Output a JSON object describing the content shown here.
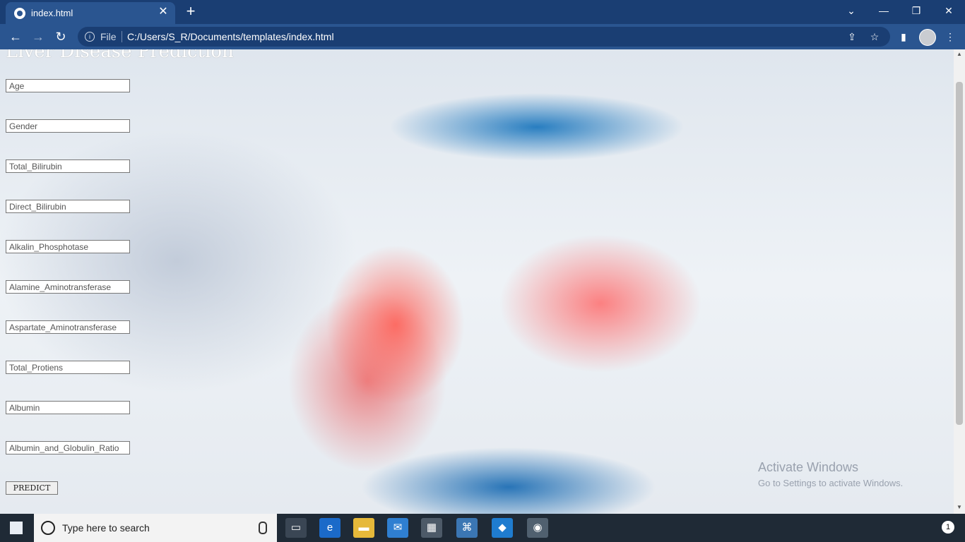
{
  "browser": {
    "tab_title": "index.html",
    "tab_close": "✕",
    "new_tab": "+",
    "window": {
      "dropdown": "⌄",
      "minimize": "—",
      "restore": "❐",
      "close": "✕"
    },
    "url_scheme": "File",
    "url": "C:/Users/S_R/Documents/templates/index.html"
  },
  "page": {
    "title": "Liver Disease Prediction",
    "fields": [
      {
        "placeholder": "Age"
      },
      {
        "placeholder": "Gender"
      },
      {
        "placeholder": "Total_Bilirubin"
      },
      {
        "placeholder": "Direct_Bilirubin"
      },
      {
        "placeholder": "Alkalin_Phosphotase"
      },
      {
        "placeholder": "Alamine_Aminotransferase"
      },
      {
        "placeholder": "Aspartate_Aminotransferase"
      },
      {
        "placeholder": "Total_Protiens"
      },
      {
        "placeholder": "Albumin"
      },
      {
        "placeholder": "Albumin_and_Globulin_Ratio"
      }
    ],
    "predict_label": "PREDICT"
  },
  "watermark": {
    "title": "Activate Windows",
    "subtitle": "Go to Settings to activate Windows."
  },
  "taskbar": {
    "search_placeholder": "Type here to search",
    "notification_count": "1"
  },
  "colors": {
    "tabbar": "#1a3e73",
    "toolbar": "#2a5590",
    "taskbar": "#1f2a36"
  }
}
